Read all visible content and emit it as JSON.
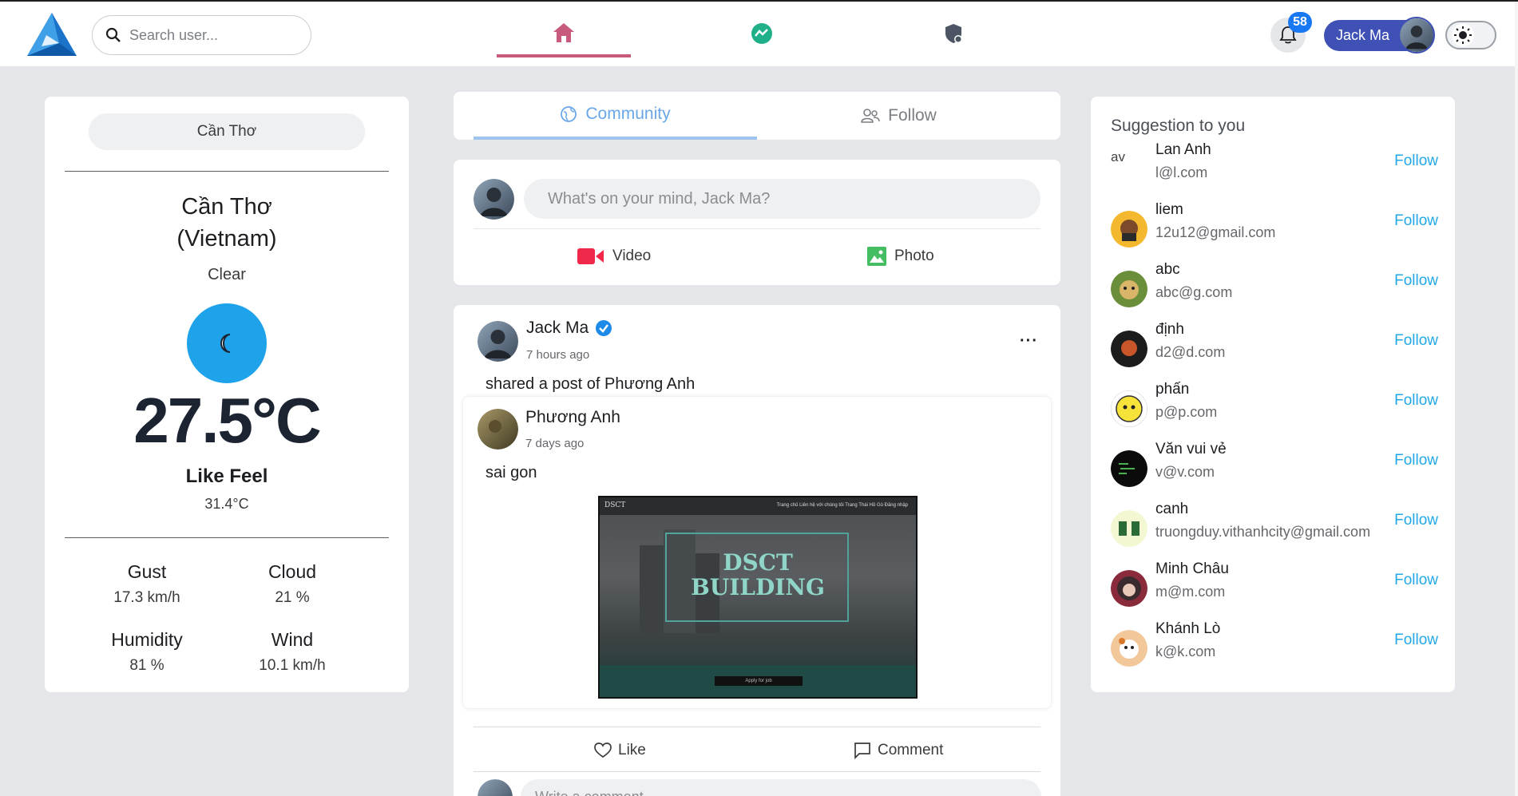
{
  "header": {
    "search_placeholder": "Search user...",
    "notification_count": "58",
    "user_name": "Jack Ma",
    "accent": "#c85a7c"
  },
  "weather": {
    "city_selector": "Cần Thơ",
    "city": "Cần Thơ",
    "country": "(Vietnam)",
    "description": "Clear",
    "temperature": "27.5°C",
    "feel_label": "Like Feel",
    "feel_value": "31.4°C",
    "gust_label": "Gust",
    "gust_value": "17.3 km/h",
    "cloud_label": "Cloud",
    "cloud_value": "21 %",
    "humidity_label": "Humidity",
    "humidity_value": "81 %",
    "wind_label": "Wind",
    "wind_value": "10.1 km/h",
    "icon": "moon-icon"
  },
  "feed": {
    "tab_community": "Community",
    "tab_follow": "Follow",
    "composer_placeholder": "What's on your mind, Jack Ma?",
    "video_label": "Video",
    "photo_label": "Photo"
  },
  "post": {
    "author": "Jack Ma",
    "time": "7 hours ago",
    "more": "···",
    "text": "shared a post of Phương Anh",
    "shared_author": "Phương Anh",
    "shared_time": "7 days ago",
    "shared_text": "sai gon",
    "image": {
      "brand": "DSCT",
      "menu": "Trang chủ   Liên hệ với chúng tôi   Trang Thái Hồ Gò   Đăng nhập",
      "headline_1": "DSCT",
      "headline_2": "BUILDING",
      "button": "Apply for job"
    },
    "like_label": "Like",
    "comment_label": "Comment",
    "comment_placeholder": "Write a comment..."
  },
  "suggestions": {
    "title": "Suggestion to you",
    "follow_label": "Follow",
    "broken_avatar_alt": "av",
    "items": [
      {
        "name": "Lan Anh",
        "email": "l@l.com"
      },
      {
        "name": "liem",
        "email": "12u12@gmail.com"
      },
      {
        "name": "abc",
        "email": "abc@g.com"
      },
      {
        "name": "định",
        "email": "d2@d.com"
      },
      {
        "name": "phấn",
        "email": "p@p.com"
      },
      {
        "name": "Văn vui vẻ",
        "email": "v@v.com"
      },
      {
        "name": "canh",
        "email": "truongduy.vithanhcity@gmail.com"
      },
      {
        "name": "Minh Châu",
        "email": "m@m.com"
      },
      {
        "name": "Khánh Lò",
        "email": "k@k.com"
      }
    ]
  }
}
